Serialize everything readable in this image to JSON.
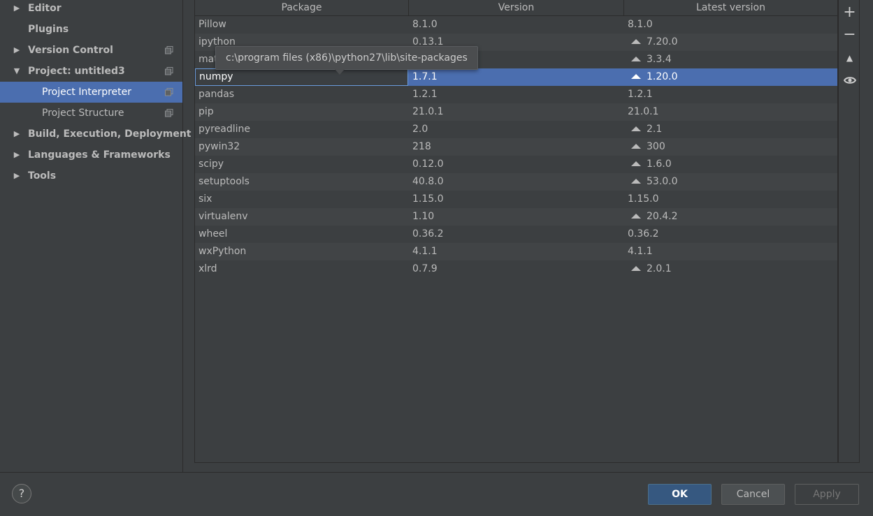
{
  "sidebar": {
    "items": [
      {
        "label": "Editor",
        "expandable": true,
        "expanded": false,
        "bold": true,
        "copy_icon": false
      },
      {
        "label": "Plugins",
        "expandable": false,
        "expanded": false,
        "bold": true,
        "copy_icon": false
      },
      {
        "label": "Version Control",
        "expandable": true,
        "expanded": false,
        "bold": true,
        "copy_icon": true
      },
      {
        "label": "Project: untitled3",
        "expandable": true,
        "expanded": true,
        "bold": true,
        "copy_icon": true
      },
      {
        "label": "Project Interpreter",
        "expandable": false,
        "expanded": false,
        "bold": false,
        "copy_icon": true,
        "selected": true
      },
      {
        "label": "Project Structure",
        "expandable": false,
        "expanded": false,
        "bold": false,
        "copy_icon": true
      },
      {
        "label": "Build, Execution, Deployment",
        "expandable": true,
        "expanded": false,
        "bold": true,
        "copy_icon": false
      },
      {
        "label": "Languages & Frameworks",
        "expandable": true,
        "expanded": false,
        "bold": true,
        "copy_icon": false
      },
      {
        "label": "Tools",
        "expandable": true,
        "expanded": false,
        "bold": true,
        "copy_icon": false
      }
    ]
  },
  "table": {
    "columns": [
      "Package",
      "Version",
      "Latest version"
    ],
    "rows": [
      {
        "package": "Pillow",
        "version": "8.1.0",
        "latest": "8.1.0",
        "upgrade": false
      },
      {
        "package": "ipython",
        "version": "0.13.1",
        "latest": "7.20.0",
        "upgrade": true
      },
      {
        "package": "mat",
        "version": "",
        "latest": "3.3.4",
        "upgrade": true
      },
      {
        "package": "numpy",
        "version": "1.7.1",
        "latest": "1.20.0",
        "upgrade": true,
        "selected": true
      },
      {
        "package": "pandas",
        "version": "1.2.1",
        "latest": "1.2.1",
        "upgrade": false
      },
      {
        "package": "pip",
        "version": "21.0.1",
        "latest": "21.0.1",
        "upgrade": false
      },
      {
        "package": "pyreadline",
        "version": "2.0",
        "latest": "2.1",
        "upgrade": true
      },
      {
        "package": "pywin32",
        "version": "218",
        "latest": "300",
        "upgrade": true
      },
      {
        "package": "scipy",
        "version": "0.12.0",
        "latest": "1.6.0",
        "upgrade": true
      },
      {
        "package": "setuptools",
        "version": "40.8.0",
        "latest": "53.0.0",
        "upgrade": true
      },
      {
        "package": "six",
        "version": "1.15.0",
        "latest": "1.15.0",
        "upgrade": false
      },
      {
        "package": "virtualenv",
        "version": "1.10",
        "latest": "20.4.2",
        "upgrade": true
      },
      {
        "package": "wheel",
        "version": "0.36.2",
        "latest": "0.36.2",
        "upgrade": false
      },
      {
        "package": "wxPython",
        "version": "4.1.1",
        "latest": "4.1.1",
        "upgrade": false
      },
      {
        "package": "xlrd",
        "version": "0.7.9",
        "latest": "2.0.1",
        "upgrade": true
      }
    ]
  },
  "tooltip": {
    "text": "c:\\program files (x86)\\python27\\lib\\site-packages"
  },
  "toolbar": {
    "add_symbol": "+",
    "remove_symbol": "−",
    "upgrade_symbol": "▲",
    "show_symbol": "◉"
  },
  "footer": {
    "help_label": "?",
    "ok_label": "OK",
    "cancel_label": "Cancel",
    "apply_label": "Apply"
  }
}
